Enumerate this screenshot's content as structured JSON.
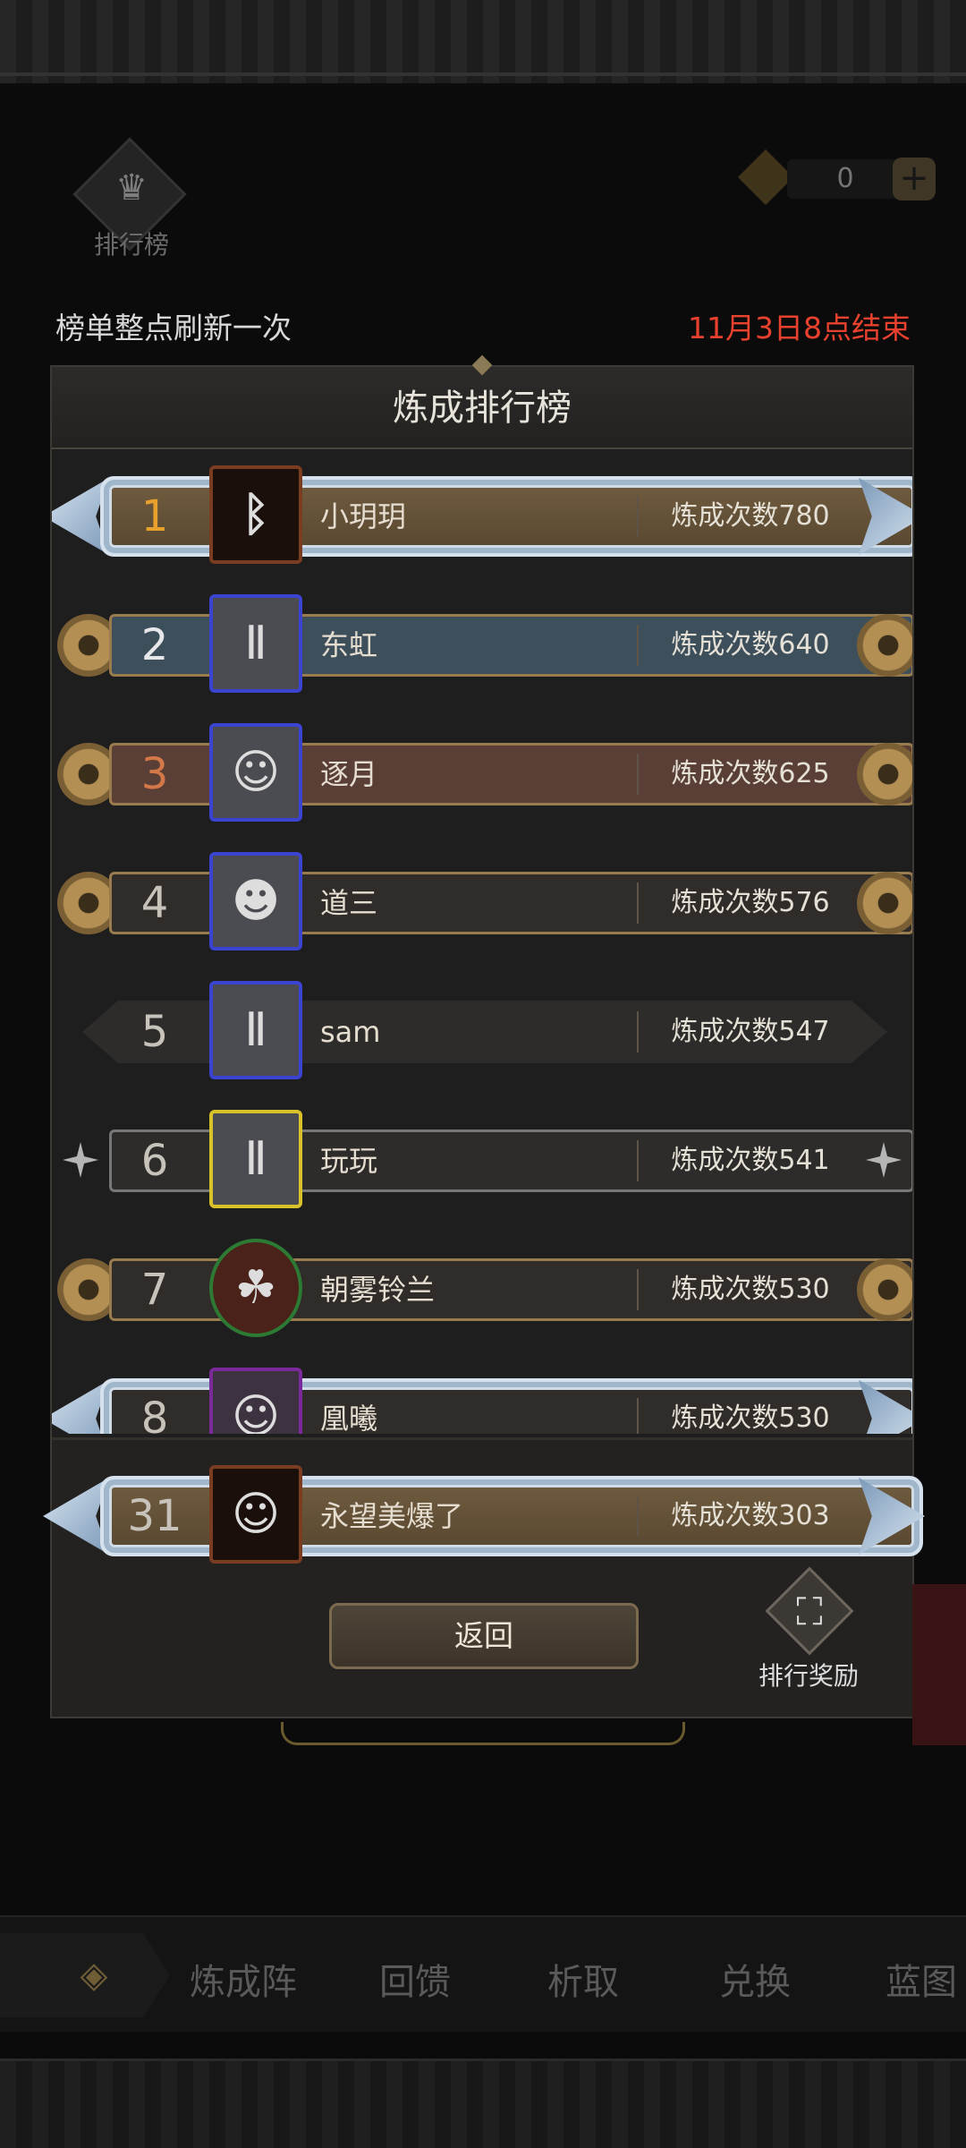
{
  "header": {
    "ranking_label": "排行榜",
    "currency_value": "0",
    "plus": "+"
  },
  "notice": {
    "refresh": "榜单整点刷新一次",
    "end_time": "11月3日8点结束"
  },
  "panel": {
    "title": "炼成排行榜"
  },
  "ranking": [
    {
      "rank": "1",
      "name": "小玥玥",
      "score": "炼成次数780"
    },
    {
      "rank": "2",
      "name": "东虹",
      "score": "炼成次数640"
    },
    {
      "rank": "3",
      "name": "逐月",
      "score": "炼成次数625"
    },
    {
      "rank": "4",
      "name": "道三",
      "score": "炼成次数576"
    },
    {
      "rank": "5",
      "name": "sam",
      "score": "炼成次数547"
    },
    {
      "rank": "6",
      "name": "玩玩",
      "score": "炼成次数541"
    },
    {
      "rank": "7",
      "name": "朝雾铃兰",
      "score": "炼成次数530"
    },
    {
      "rank": "8",
      "name": "凰曦",
      "score": "炼成次数530"
    }
  ],
  "self": {
    "rank": "31",
    "name": "永望美爆了",
    "score": "炼成次数303"
  },
  "buttons": {
    "back": "返回",
    "reward": "排行奖励"
  },
  "tabs": [
    "炼成阵",
    "回馈",
    "析取",
    "兑换",
    "蓝图"
  ],
  "colors": {
    "accent_red": "#e8412e",
    "rank_gold": "#e8a12d",
    "rank_silver": "#e7e7ea",
    "rank_copper": "#d4784a"
  },
  "icons": [
    "crown-icon",
    "gem-icon",
    "plus-icon",
    "chest-icon",
    "selector-arrow-icon"
  ]
}
